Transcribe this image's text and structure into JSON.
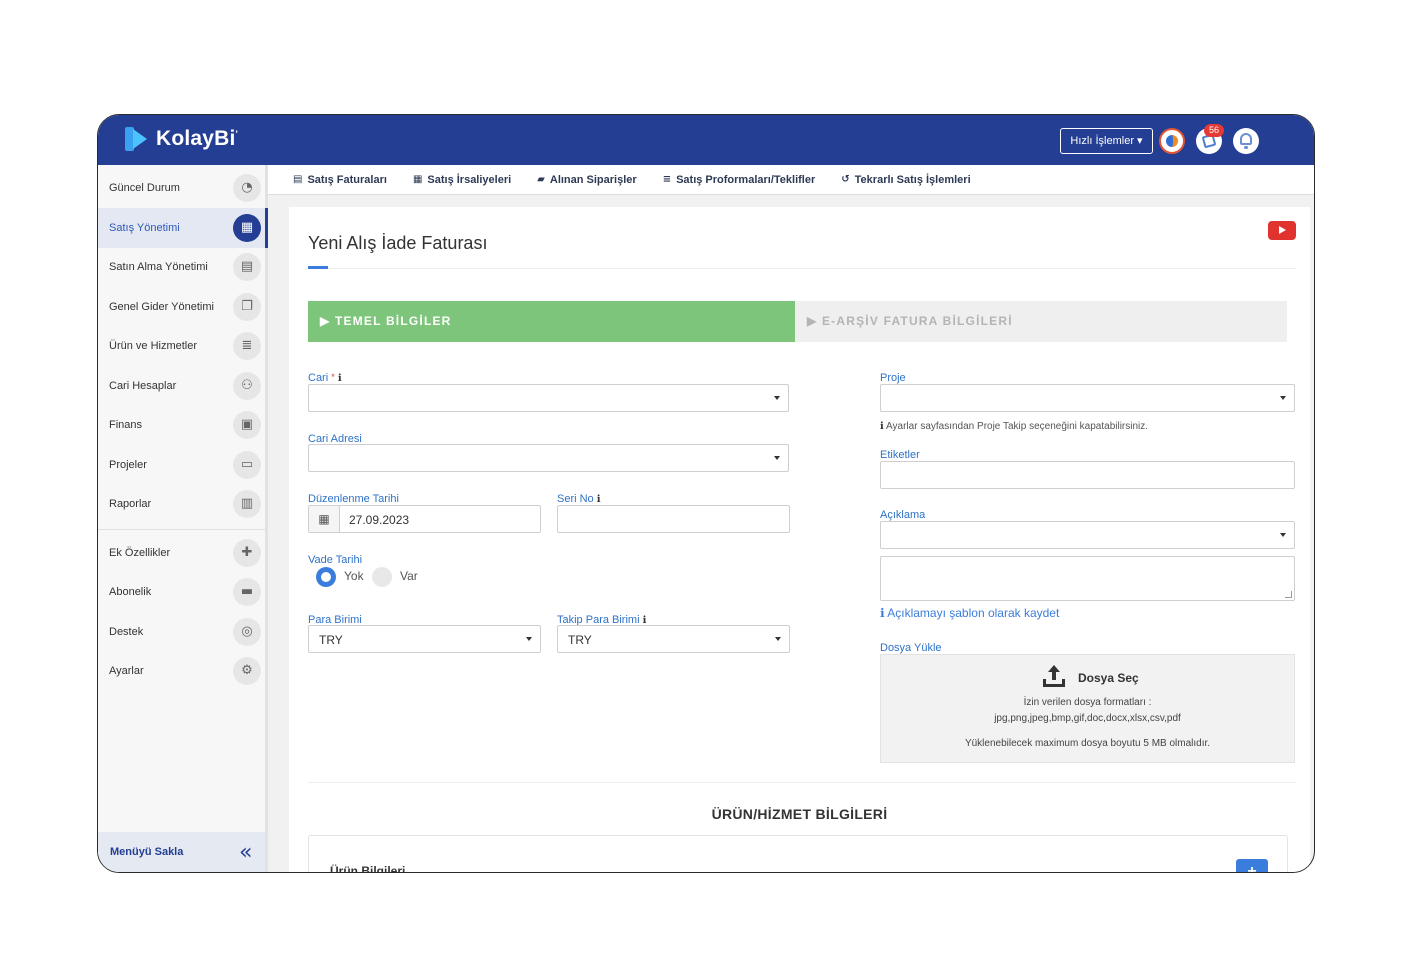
{
  "app": {
    "logo": "KolayBi",
    "logo_mark": "'"
  },
  "header": {
    "quick_actions": "Hızlı İşlemler ▾",
    "notification_count": "56",
    "icons": [
      "app-switch-icon",
      "message-icon",
      "bell-icon"
    ]
  },
  "sidebar": {
    "items": [
      {
        "label": "Güncel Durum",
        "icon": "◔"
      },
      {
        "label": "Satış Yönetimi",
        "icon": "▦",
        "active": true
      },
      {
        "label": "Satın Alma Yönetimi",
        "icon": "▤"
      },
      {
        "label": "Genel Gider Yönetimi",
        "icon": "❐"
      },
      {
        "label": "Ürün ve Hizmetler",
        "icon": "≣"
      },
      {
        "label": "Cari Hesaplar",
        "icon": "⚇"
      },
      {
        "label": "Finans",
        "icon": "▣"
      },
      {
        "label": "Projeler",
        "icon": "▭"
      },
      {
        "label": "Raporlar",
        "icon": "▥"
      },
      {
        "label": "Ek Özellikler",
        "icon": "✚"
      },
      {
        "label": "Abonelik",
        "icon": "▬"
      },
      {
        "label": "Destek",
        "icon": "◎"
      },
      {
        "label": "Ayarlar",
        "icon": "⚙"
      }
    ],
    "footer": {
      "label": "Menüyü Sakla",
      "icon": "«"
    }
  },
  "tabs": [
    {
      "label": "Satış Faturaları",
      "icon": "▤"
    },
    {
      "label": "Satış İrsaliyeleri",
      "icon": "▦"
    },
    {
      "label": "Alınan Siparişler",
      "icon": "▰"
    },
    {
      "label": "Satış Proformaları/Teklifler",
      "icon": "≡"
    },
    {
      "label": "Tekrarlı Satış İşlemleri",
      "icon": "↺"
    }
  ],
  "page": {
    "title": "Yeni Alış İade Faturası",
    "steps": {
      "active": "▶ TEMEL BİLGİLER",
      "inactive": "▶ E-ARŞİV FATURA BİLGİLERİ"
    }
  },
  "form": {
    "cari": {
      "label": "Cari",
      "required": "*",
      "info": "ℹ",
      "value": ""
    },
    "cari_adresi": {
      "label": "Cari Adresi",
      "value": ""
    },
    "duzenlenme_tarihi": {
      "label": "Düzenlenme Tarihi",
      "value": "27.09.2023",
      "icon": "▦"
    },
    "seri_no": {
      "label": "Seri No",
      "info": "ℹ",
      "value": ""
    },
    "vade_tarihi": {
      "label": "Vade Tarihi",
      "options": [
        "Yok",
        "Var"
      ],
      "selected": "Yok"
    },
    "para_birimi": {
      "label": "Para Birimi",
      "value": "TRY"
    },
    "takip_para_birimi": {
      "label": "Takip Para Birimi",
      "info": "ℹ",
      "value": "TRY"
    },
    "proje": {
      "label": "Proje",
      "value": "",
      "note": "Ayarlar sayfasından Proje Takip seçeneğini kapatabilirsiniz.",
      "note_icon": "ℹ"
    },
    "etiketler": {
      "label": "Etiketler",
      "value": ""
    },
    "aciklama": {
      "label": "Açıklama",
      "value": "",
      "save_template": "Açıklamayı şablon olarak kaydet",
      "save_icon": "ℹ"
    },
    "dosya": {
      "label": "Dosya Yükle",
      "button": "Dosya Seç",
      "formats_title": "İzin verilen dosya formatları :",
      "formats": "jpg,png,jpeg,bmp,gif,doc,docx,xlsx,csv,pdf",
      "max_size": "Yüklenebilecek maximum dosya boyutu 5 MB olmalıdır."
    }
  },
  "products": {
    "section_title": "ÜRÜN/HİZMET BİLGİLERİ",
    "panel_label": "Ürün Bilgileri",
    "add_button": "+"
  }
}
